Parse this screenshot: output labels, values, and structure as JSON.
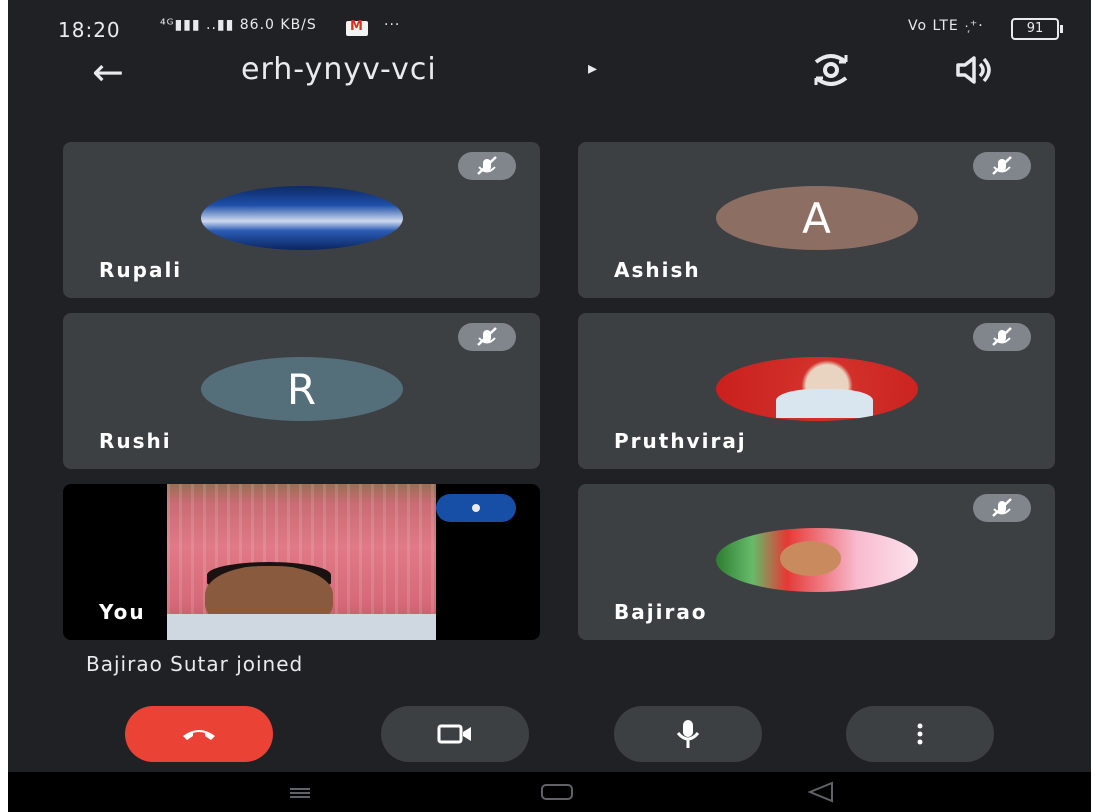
{
  "status_bar": {
    "time": "18:20",
    "signal_text": "⁴ᴳ▮▮▮ ..▮▮ 86.0 KB/S",
    "extra_dots": "···",
    "right_text": "Vo LTE ·᷊⁺·",
    "battery": "91"
  },
  "app_bar": {
    "meeting_code": "erh-ynyv-vci",
    "caret": "▸",
    "back_icon": "arrow-left",
    "switch_camera_icon": "switch-camera",
    "speaker_icon": "speaker"
  },
  "participants": [
    {
      "name": "Rupali",
      "avatar_letter": "",
      "muted": true
    },
    {
      "name": "Ashish",
      "avatar_letter": "A",
      "avatar_color": "#8d6e63",
      "muted": true
    },
    {
      "name": "Rushi",
      "avatar_letter": "R",
      "avatar_color": "#546e7a",
      "muted": true
    },
    {
      "name": "Pruthviraj",
      "avatar_letter": "",
      "muted": true
    },
    {
      "name": "You",
      "self": true,
      "muted": false
    },
    {
      "name": "Bajirao",
      "avatar_letter": "",
      "muted": true
    }
  ],
  "toast": "Bajirao Sutar joined",
  "controls": {
    "end_call_icon": "phone-hangup",
    "camera_icon": "video-camera",
    "mic_icon": "microphone",
    "more_icon": "more-vertical",
    "end_call_color": "#ea4335"
  },
  "colors": {
    "background": "#202124",
    "tile": "#3c4043",
    "speaking_indicator": "#174ea6"
  }
}
